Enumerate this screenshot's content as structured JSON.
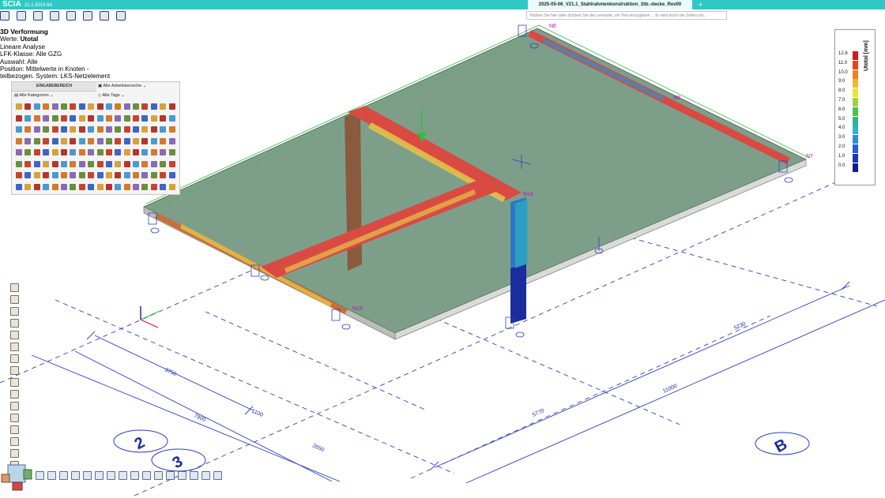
{
  "app": {
    "logo": "SCIA",
    "version": "21.1.5015.64"
  },
  "tabs": {
    "document": "2025-05-06_V21.1_Stahlrahmenkonstruktion_Stb.-decke_Rev00",
    "new_tab": "+"
  },
  "command_line": {
    "placeholder": "Klicken Sie hier oder drücken Sie die Leertaste, um Text einzugeben ... Er wird durch die Zeilen unt..."
  },
  "quick_access_icons": [
    "new-icon",
    "open-icon",
    "tools-icon",
    "cube-icon",
    "render-icon",
    "eye-icon",
    "view-icon",
    "zoom-icon"
  ],
  "info_panel": {
    "title": "3D Verformung",
    "values_label": "Werte:",
    "values": "Utotal",
    "analysis": "Lineare Analyse",
    "load_class": "LFK-Klasse:  Alle GZG",
    "selection": "Auswahl: Alle",
    "position": "Position: Mittelwerte  in Knoten -",
    "system": "teilbezogen. System: LKS-Netzelement"
  },
  "palette": {
    "header": "EINGABEBEREICH",
    "categories": "Alle Kategorien",
    "work_areas": "Alle Arbeitsbereiche",
    "tags": "Alle Tags"
  },
  "legend": {
    "unit": "Utotal [mm]",
    "values": [
      "12.6",
      "11.0",
      "10.0",
      "9.0",
      "8.0",
      "7.0",
      "6.0",
      "5.0",
      "4.0",
      "3.0",
      "2.0",
      "1.0",
      "0.0"
    ],
    "colors": [
      "#d8151a",
      "#e9431b",
      "#f0801f",
      "#f0b72a",
      "#e8e23a",
      "#a2d23a",
      "#4cc24a",
      "#28b88a",
      "#2fb3c8",
      "#2a8fd6",
      "#2460d0",
      "#1d34b4",
      "#0e1c8c"
    ]
  },
  "nodes": [
    "N6",
    "N7",
    "N8",
    "N14",
    "N15"
  ],
  "dimensions": [
    "3750",
    "7900",
    "1100",
    "2650",
    "5770",
    "5230",
    "11000"
  ],
  "grid_axes": [
    "2",
    "3",
    "B"
  ]
}
